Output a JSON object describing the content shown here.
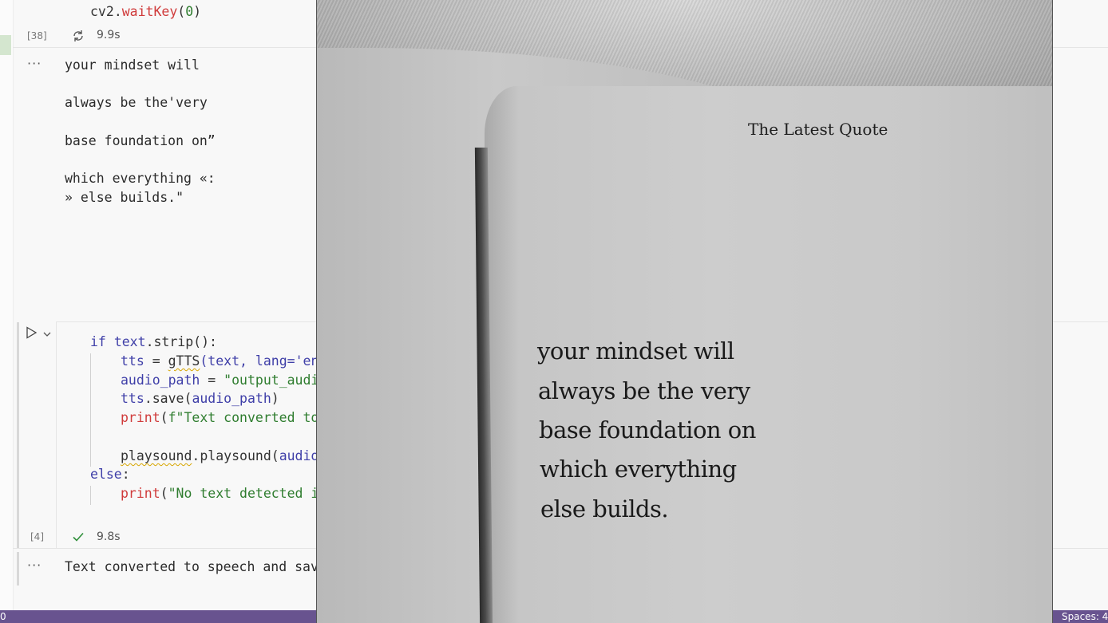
{
  "cell1": {
    "code_tail": {
      "object": "cv2",
      "method": "waitKey",
      "arg": "0"
    },
    "exec_count": "[38]",
    "exec_time": "9.9s",
    "status_icon": "refresh-icon"
  },
  "output1": {
    "ellipsis": "···",
    "lines": [
      "your mindset will",
      "always be the'very",
      "base foundation on”",
      "which everything «:",
      "» else builds.\""
    ]
  },
  "cell2": {
    "run_icon": "play-icon",
    "expand_icon": "chevron-down-icon",
    "code": {
      "l1": {
        "kw": "if",
        "obj": "text",
        "method": "strip",
        "tail": ":"
      },
      "l2": {
        "var": "tts",
        "op": " = ",
        "fn": "gTTS",
        "args": "(text, lang='en"
      },
      "l3": {
        "var": "audio_path",
        "op": " = ",
        "str": "\"output_audio"
      },
      "l4": {
        "obj": "tts",
        "method": "save",
        "arg": "audio_path"
      },
      "l5": {
        "fn": "print",
        "str": "f\"Text converted to "
      },
      "l6": {
        "obj": "playsound",
        "method": "playsound",
        "arg": "audio_"
      },
      "l7": {
        "kw": "else",
        "tail": ":"
      },
      "l8": {
        "fn": "print",
        "str": "\"No text detected in"
      }
    },
    "exec_count": "[4]",
    "exec_time": "9.8s",
    "status_icon": "check-icon"
  },
  "output2": {
    "ellipsis": "···",
    "text": "Text converted to speech and save"
  },
  "status_bar": {
    "left": "0",
    "right": "Spaces: 4"
  },
  "viewer": {
    "book_title": "The Latest Quote",
    "quote_lines": [
      "your mindset will",
      "always be the very",
      "base foundation on",
      "which everything",
      "else builds."
    ]
  }
}
